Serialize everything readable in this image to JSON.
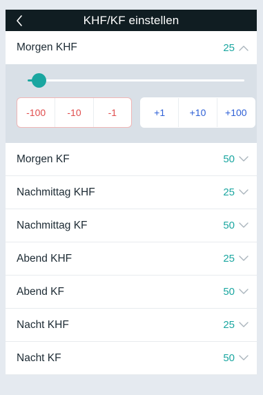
{
  "header": {
    "title": "KHF/KF einstellen",
    "back_icon": "chevron-left-icon"
  },
  "expanded_item": {
    "label": "Morgen KHF",
    "value": "25",
    "icon": "chevron-up-icon",
    "slider": {
      "value": 25,
      "min": 0,
      "max": 500
    },
    "decrement_buttons": [
      "-100",
      "-10",
      "-1"
    ],
    "increment_buttons": [
      "+1",
      "+10",
      "+100"
    ]
  },
  "items": [
    {
      "label": "Morgen KF",
      "value": "50",
      "icon": "chevron-down-icon"
    },
    {
      "label": "Nachmittag KHF",
      "value": "25",
      "icon": "chevron-down-icon"
    },
    {
      "label": "Nachmittag KF",
      "value": "50",
      "icon": "chevron-down-icon"
    },
    {
      "label": "Abend KHF",
      "value": "25",
      "icon": "chevron-down-icon"
    },
    {
      "label": "Abend KF",
      "value": "50",
      "icon": "chevron-down-icon"
    },
    {
      "label": "Nacht KHF",
      "value": "25",
      "icon": "chevron-down-icon"
    },
    {
      "label": "Nacht KF",
      "value": "50",
      "icon": "chevron-down-icon"
    }
  ],
  "colors": {
    "header_bg": "#101d22",
    "accent": "#1aa6a0",
    "decrement": "#e04c4c",
    "increment": "#2d5fd6",
    "panel_bg": "#d9e0e7",
    "page_bg": "#e5eaf0"
  }
}
